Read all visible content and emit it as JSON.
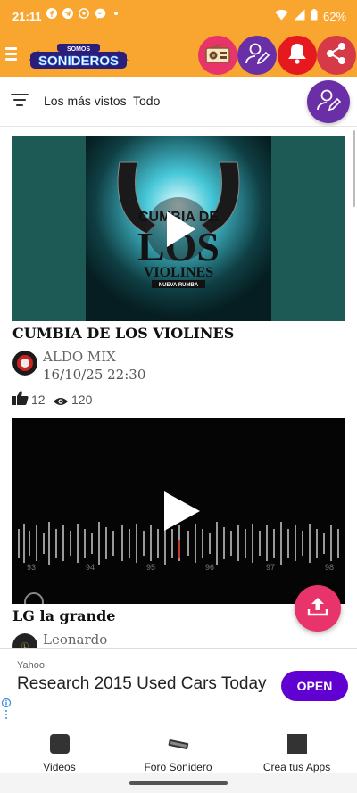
{
  "status_bar": {
    "time": "21:11",
    "battery": "62%",
    "notification_icons": [
      "facebook-icon",
      "telegram-icon",
      "whatsapp-icon",
      "messenger-icon",
      "dot-icon"
    ]
  },
  "app_bar": {
    "logo_top": "SOMOS",
    "logo_main": "SONIDEROS",
    "buttons": [
      "radio-icon",
      "user-edit-icon",
      "bell-icon",
      "share-icon"
    ],
    "colors": {
      "background": "#f9a630",
      "radio": "#e8336b",
      "user": "#6a2fa6",
      "bell": "#e5191e",
      "share": "#d63a47"
    }
  },
  "filter": {
    "sort_label": "Los más vistos",
    "scope_label": "Todo"
  },
  "feed": [
    {
      "title": "CUMBIA DE LOS VIOLINES",
      "thumb_text_top": "CUMBIA DE",
      "thumb_text_mid": "LOS",
      "thumb_text_main": "VIOLINES",
      "thumb_text_sub": "NUEVA RUMBA",
      "author": "ALDO MIX",
      "date": "16/10/25 22:30",
      "likes": "12",
      "views": "120"
    },
    {
      "title": "LG la grande",
      "waveform_labels": [
        "93",
        "94",
        "95",
        "96",
        "97",
        "98"
      ],
      "author": "Leonardo"
    }
  ],
  "ad": {
    "source": "Yahoo",
    "headline": "Research 2015 Used Cars Today",
    "cta": "OPEN",
    "cta_color": "#6001d2"
  },
  "bottom_nav": [
    {
      "label": "Videos",
      "icon": "video-square-icon"
    },
    {
      "label": "Foro Sonidero",
      "icon": "forum-badge-icon"
    },
    {
      "label": "Crea tus Apps",
      "icon": "apps-square-icon"
    }
  ]
}
